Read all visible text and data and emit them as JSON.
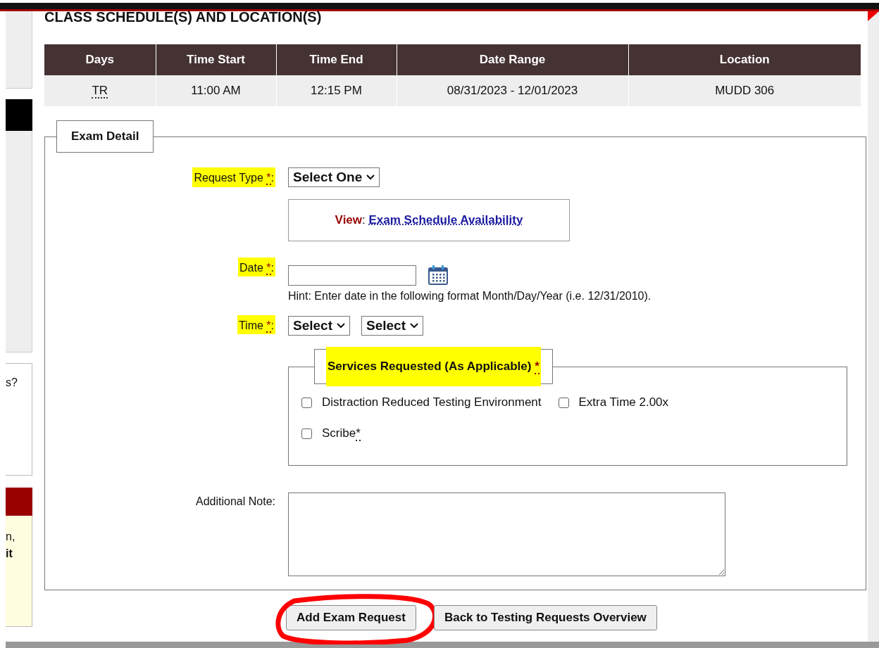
{
  "sidebar": {
    "fragments": [
      {
        "text": "s?",
        "bold": false
      },
      {
        "text": "n,",
        "bold": false
      },
      {
        "text": "it",
        "bold": true
      }
    ]
  },
  "schedule": {
    "title": "CLASS SCHEDULE(S) AND LOCATION(S)",
    "columns": [
      "Days",
      "Time Start",
      "Time End",
      "Date Range",
      "Location"
    ],
    "rows": [
      [
        {
          "text": "TR",
          "abbr": true
        },
        {
          "text": "11:00 AM",
          "abbr": false
        },
        {
          "text": "12:15 PM",
          "abbr": false
        },
        {
          "text": "08/31/2023 - 12/01/2023",
          "abbr": false
        },
        {
          "text": "MUDD 306",
          "abbr": false
        }
      ]
    ]
  },
  "exam_detail": {
    "legend": "Exam Detail",
    "request_type": {
      "label": "Request Type",
      "mark": "*",
      "colon": ":",
      "highlighted": true,
      "value": "Select One"
    },
    "view": {
      "label": "View",
      "colon": ":",
      "link": "Exam Schedule Availability"
    },
    "date": {
      "label": "Date",
      "mark": "*",
      "colon": ":",
      "highlighted": true,
      "hint": "Hint: Enter date in the following format Month/Day/Year (i.e. 12/31/2010)."
    },
    "time": {
      "label": "Time",
      "mark": "*",
      "colon": ":",
      "highlighted": true,
      "selects": [
        "Select",
        "Select"
      ]
    },
    "services": {
      "legend": "Services Requested (As Applicable)",
      "mark": "*",
      "highlighted": true,
      "options": [
        {
          "label": "Distraction Reduced Testing Environment",
          "checked": false
        },
        {
          "label": "Extra Time 2.00x",
          "checked": false
        },
        {
          "label": "Scribe",
          "mark": "*",
          "checked": false
        }
      ]
    },
    "note": {
      "label": "Additional Note:"
    }
  },
  "buttons": [
    {
      "label": "Add Exam Request",
      "circled": true
    },
    {
      "label": "Back to Testing Requests Overview",
      "circled": false
    }
  ]
}
